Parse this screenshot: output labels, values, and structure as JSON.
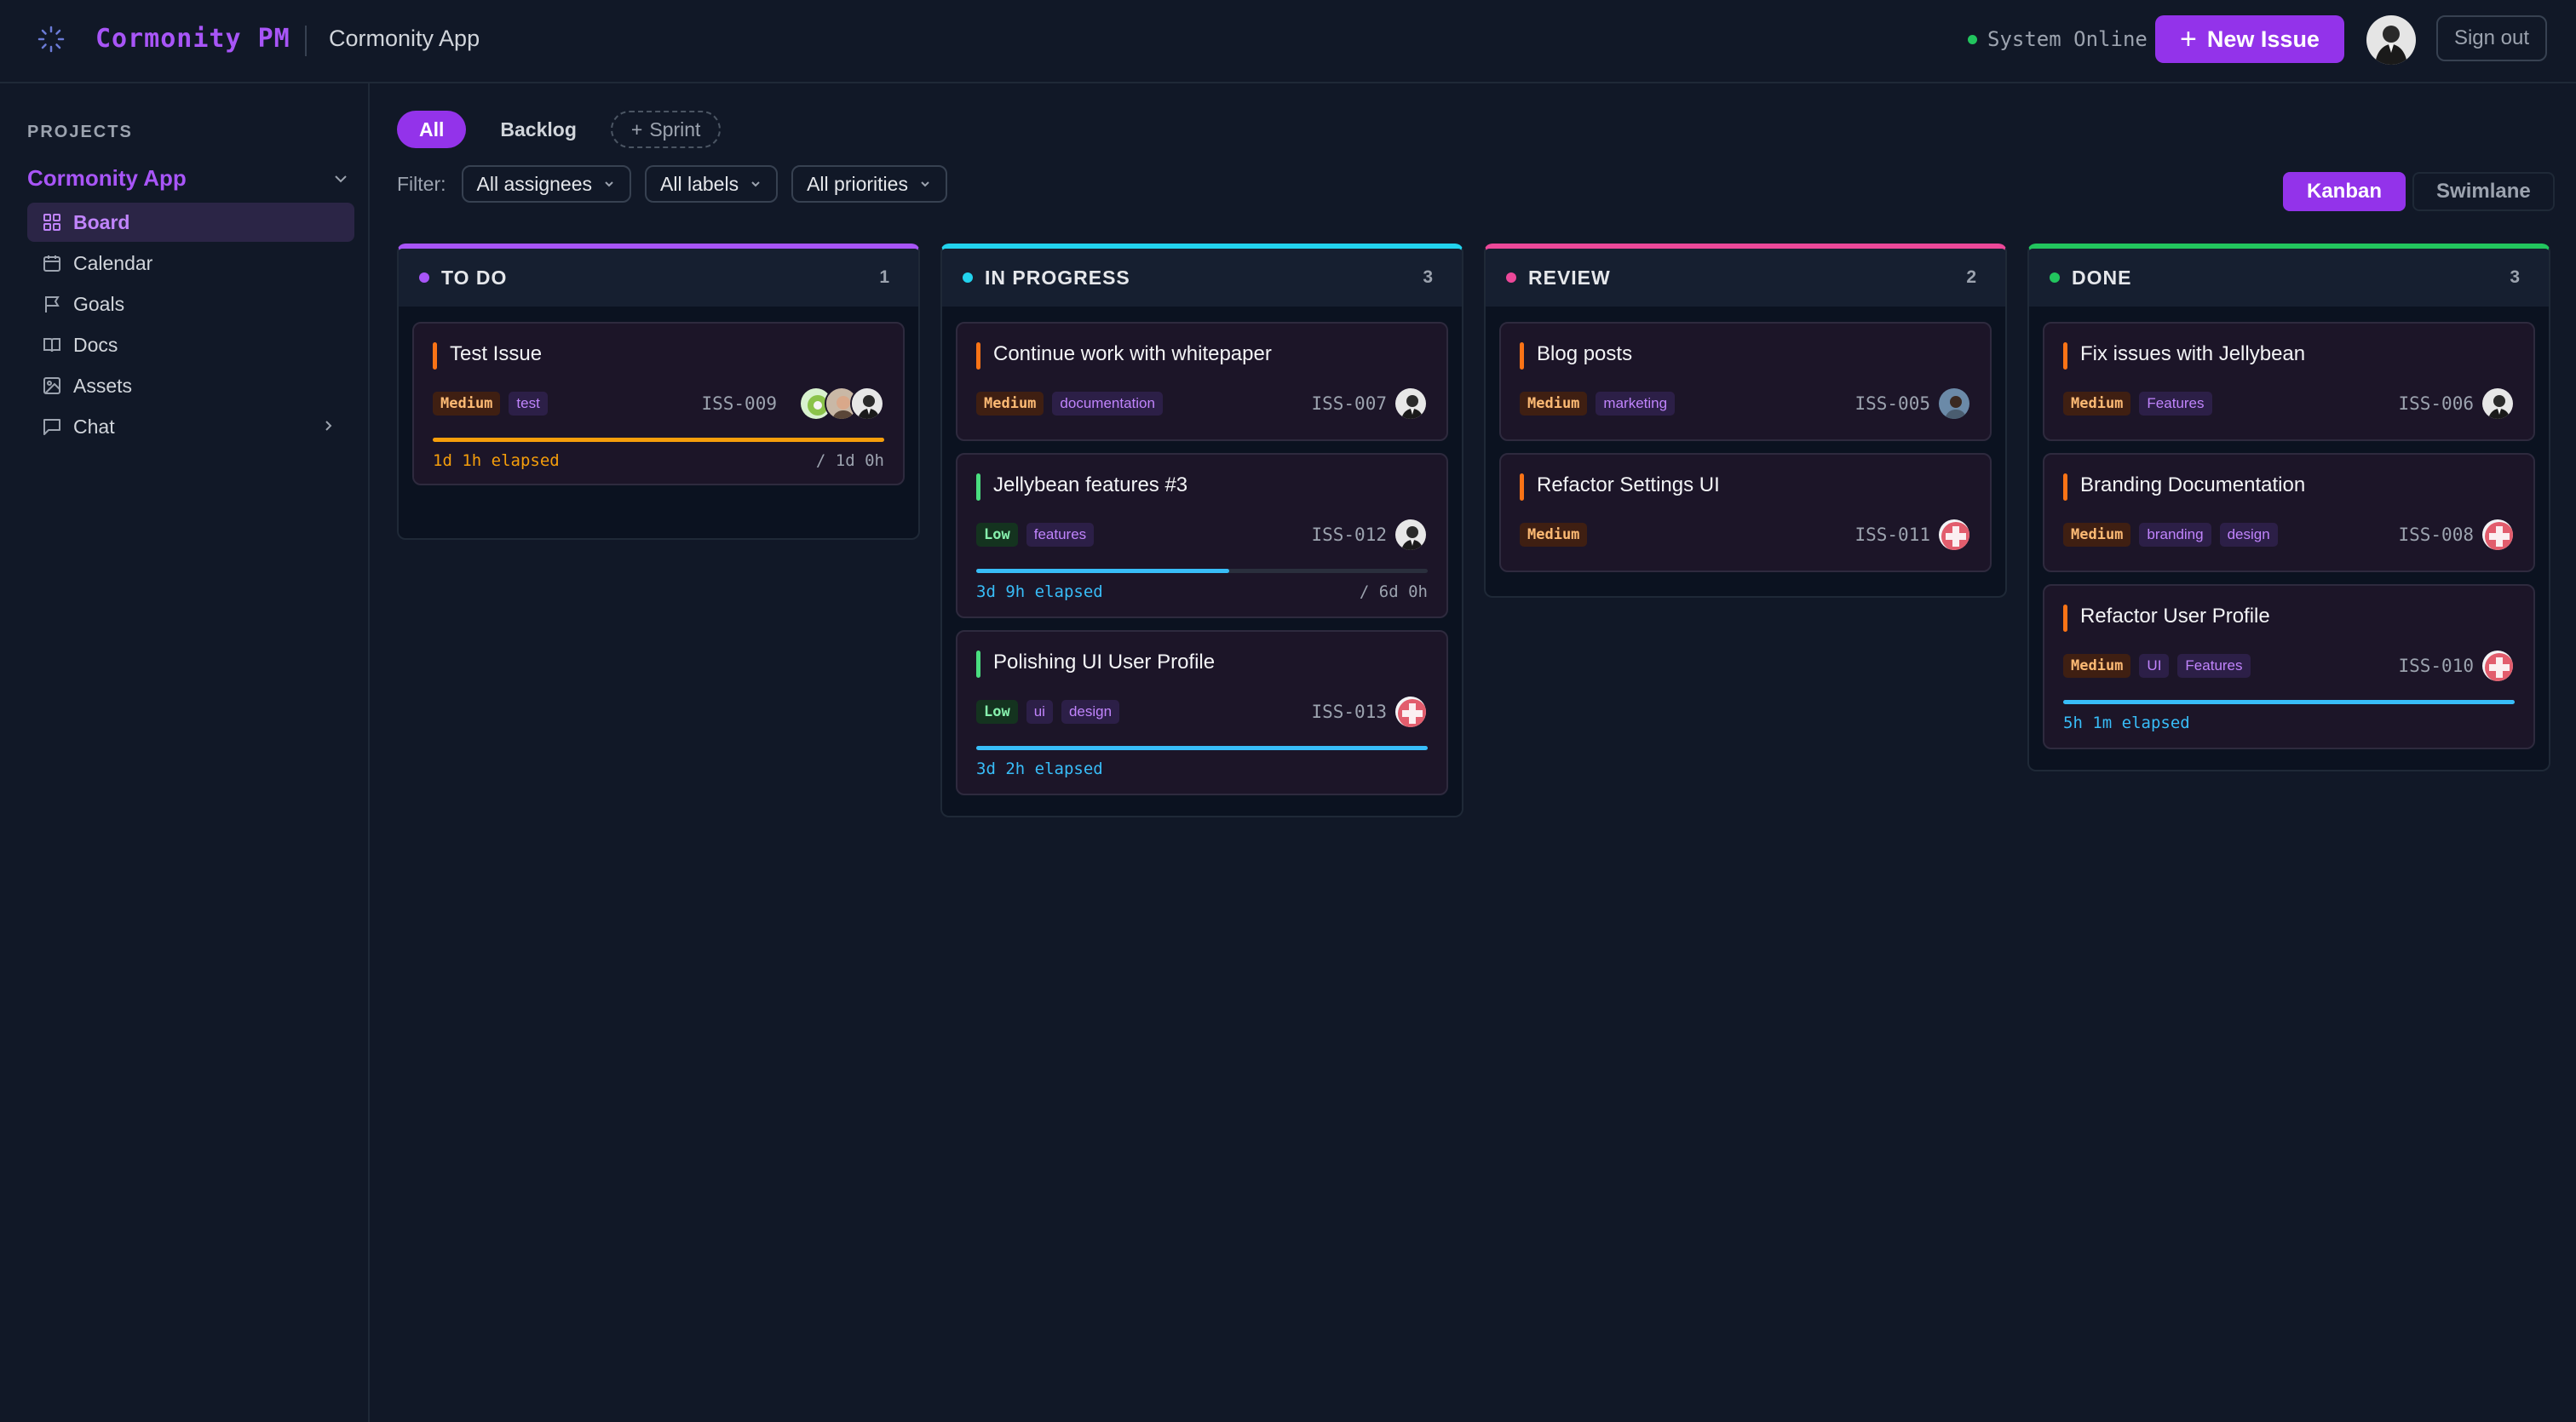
{
  "header": {
    "brand": "Cormonity PM",
    "project_name": "Cormonity App",
    "status_text": "System Online",
    "new_issue_label": "New Issue",
    "sign_out_label": "Sign out",
    "accent_color": "#9333ea"
  },
  "sidebar": {
    "heading": "PROJECTS",
    "project": "Cormonity App",
    "items": [
      {
        "label": "Board",
        "icon": "grid-icon",
        "active": true
      },
      {
        "label": "Calendar",
        "icon": "calendar-icon"
      },
      {
        "label": "Goals",
        "icon": "flag-icon"
      },
      {
        "label": "Docs",
        "icon": "book-icon"
      },
      {
        "label": "Assets",
        "icon": "image-icon"
      },
      {
        "label": "Chat",
        "icon": "chat-icon"
      }
    ]
  },
  "tabs": {
    "all": "All",
    "backlog": "Backlog",
    "sprint": "Sprint"
  },
  "filters": {
    "label": "Filter:",
    "assignees": "All assignees",
    "labels": "All labels",
    "priorities": "All priorities"
  },
  "view_toggle": {
    "kanban": "Kanban",
    "swimlane": "Swimlane"
  },
  "columns": [
    {
      "title": "TO DO",
      "count": "1",
      "color": "#a855f7",
      "cards": [
        {
          "title": "Test Issue",
          "priority": "Medium",
          "labels": [
            "test"
          ],
          "id": "ISS-009",
          "elapsed": "1d 1h elapsed",
          "remaining": "/ 1d 0h",
          "progress": 1.0,
          "progress_color": "#f59e0b"
        }
      ]
    },
    {
      "title": "IN PROGRESS",
      "count": "3",
      "color": "#22d3ee",
      "cards": [
        {
          "title": "Continue work with whitepaper",
          "priority": "Medium",
          "labels": [
            "documentation"
          ],
          "id": "ISS-007"
        },
        {
          "title": "Jellybean features #3",
          "priority": "Low",
          "labels": [
            "features"
          ],
          "id": "ISS-012",
          "elapsed": "3d 9h elapsed",
          "remaining": "/ 6d 0h",
          "progress": 0.56,
          "progress_color": "#38bdf8"
        },
        {
          "title": "Polishing UI User Profile",
          "priority": "Low",
          "labels": [
            "ui",
            "design"
          ],
          "id": "ISS-013",
          "elapsed": "3d 2h elapsed",
          "progress": 1.0,
          "progress_color": "#38bdf8"
        }
      ]
    },
    {
      "title": "REVIEW",
      "count": "2",
      "color": "#ec4899",
      "cards": [
        {
          "title": "Blog posts",
          "priority": "Medium",
          "labels": [
            "marketing"
          ],
          "id": "ISS-005"
        },
        {
          "title": "Refactor Settings UI",
          "priority": "Medium",
          "labels": [],
          "id": "ISS-011"
        }
      ]
    },
    {
      "title": "DONE",
      "count": "3",
      "color": "#22c55e",
      "cards": [
        {
          "title": "Fix issues with Jellybean",
          "priority": "Medium",
          "labels": [
            "Features"
          ],
          "id": "ISS-006"
        },
        {
          "title": "Branding Documentation",
          "priority": "Medium",
          "labels": [
            "branding",
            "design"
          ],
          "id": "ISS-008"
        },
        {
          "title": "Refactor User Profile",
          "priority": "Medium",
          "labels": [
            "UI",
            "Features"
          ],
          "id": "ISS-010",
          "elapsed": "5h 1m elapsed",
          "progress": 1.0,
          "progress_color": "#38bdf8"
        }
      ]
    }
  ]
}
